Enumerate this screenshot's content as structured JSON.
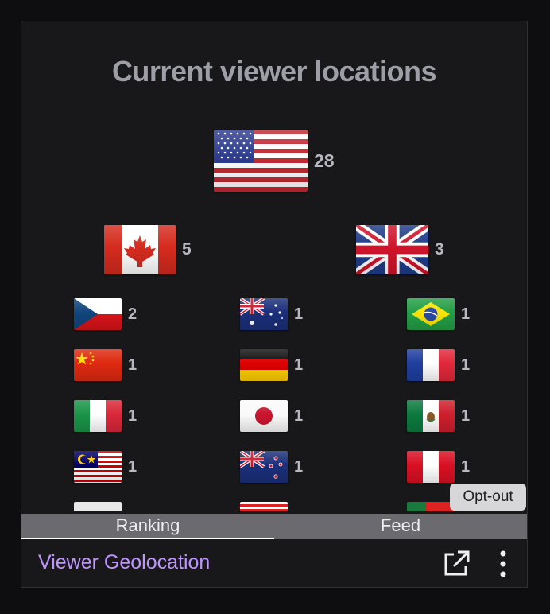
{
  "title": "Current viewer locations",
  "rankings": [
    {
      "country": "United States",
      "flag": "us-flag-icon",
      "count": "28"
    },
    {
      "country": "Canada",
      "flag": "canada-flag-icon",
      "count": "5"
    },
    {
      "country": "United Kingdom",
      "flag": "uk-flag-icon",
      "count": "3"
    },
    {
      "country": "Czech Republic",
      "flag": "czech-flag-icon",
      "count": "2"
    },
    {
      "country": "Australia",
      "flag": "australia-flag-icon",
      "count": "1"
    },
    {
      "country": "Brazil",
      "flag": "brazil-flag-icon",
      "count": "1"
    },
    {
      "country": "China",
      "flag": "china-flag-icon",
      "count": "1"
    },
    {
      "country": "Germany",
      "flag": "germany-flag-icon",
      "count": "1"
    },
    {
      "country": "France",
      "flag": "france-flag-icon",
      "count": "1"
    },
    {
      "country": "Italy",
      "flag": "italy-flag-icon",
      "count": "1"
    },
    {
      "country": "Japan",
      "flag": "japan-flag-icon",
      "count": "1"
    },
    {
      "country": "Mexico",
      "flag": "mexico-flag-icon",
      "count": "1"
    },
    {
      "country": "Malaysia",
      "flag": "malaysia-flag-icon",
      "count": "1"
    },
    {
      "country": "New Zealand",
      "flag": "new-zealand-flag-icon",
      "count": "1"
    },
    {
      "country": "Peru",
      "flag": "peru-flag-icon",
      "count": "1"
    }
  ],
  "tabs": {
    "ranking": "Ranking",
    "feed": "Feed"
  },
  "opt_out_label": "Opt-out",
  "footer": {
    "title": "Viewer Geolocation"
  },
  "colors": {
    "accent": "#bf94ff",
    "background": "#18181b",
    "tab_bar": "#6b6b6f"
  }
}
